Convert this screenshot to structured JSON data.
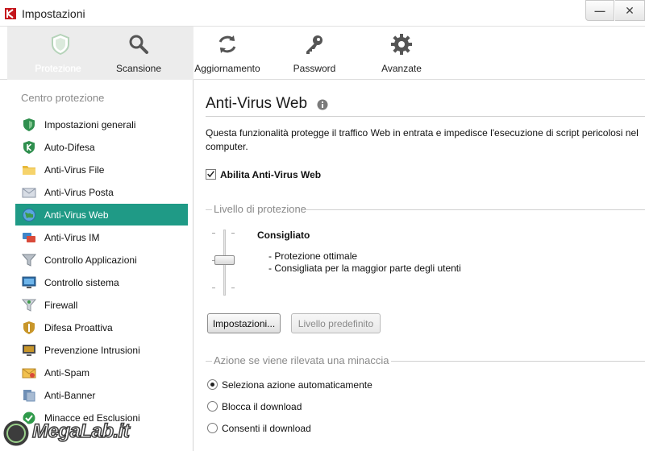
{
  "window": {
    "title": "Impostazioni",
    "minimize_glyph": "—",
    "close_glyph": "✕"
  },
  "toolbar": {
    "items": [
      {
        "label": "Protezione",
        "icon": "shield-icon",
        "active": true
      },
      {
        "label": "Scansione",
        "icon": "magnifier-icon",
        "active": false
      },
      {
        "label": "Aggiornamento",
        "icon": "refresh-icon",
        "active": false
      },
      {
        "label": "Password",
        "icon": "key-icon",
        "active": false
      },
      {
        "label": "Avanzate",
        "icon": "gear-icon",
        "active": false
      }
    ]
  },
  "sidebar": {
    "heading": "Centro protezione",
    "items": [
      {
        "label": "Impostazioni generali",
        "icon": "shield-icon"
      },
      {
        "label": "Auto-Difesa",
        "icon": "k-shield-icon"
      },
      {
        "label": "Anti-Virus File",
        "icon": "folder-icon"
      },
      {
        "label": "Anti-Virus Posta",
        "icon": "envelope-icon"
      },
      {
        "label": "Anti-Virus Web",
        "icon": "globe-icon",
        "selected": true
      },
      {
        "label": "Anti-Virus IM",
        "icon": "chat-icon"
      },
      {
        "label": "Controllo Applicazioni",
        "icon": "funnel-icon"
      },
      {
        "label": "Controllo sistema",
        "icon": "monitor-icon"
      },
      {
        "label": "Firewall",
        "icon": "firewall-icon"
      },
      {
        "label": "Difesa Proattiva",
        "icon": "proactive-shield-icon"
      },
      {
        "label": "Prevenzione Intrusioni",
        "icon": "intrusion-monitor-icon"
      },
      {
        "label": "Anti-Spam",
        "icon": "spam-envelope-icon"
      },
      {
        "label": "Anti-Banner",
        "icon": "banner-icon"
      },
      {
        "label": "Minacce ed Esclusioni",
        "icon": "check-circle-icon"
      }
    ]
  },
  "main": {
    "title": "Anti-Virus Web",
    "description": "Questa funzionalità protegge il traffico Web in entrata e impedisce l'esecuzione di script pericolosi nel computer.",
    "enable_label": "Abilita Anti-Virus Web",
    "enable_checked": true,
    "protection_group_title": "Livello di protezione",
    "level": {
      "name": "Consigliato",
      "lines": [
        "- Protezione ottimale",
        "- Consigliata per la maggior parte degli utenti"
      ]
    },
    "buttons": {
      "settings": "Impostazioni...",
      "default_level": "Livello predefinito"
    },
    "action_group_title": "Azione se viene rilevata una minaccia",
    "actions": [
      {
        "label": "Seleziona azione automaticamente",
        "selected": true
      },
      {
        "label": "Blocca il download",
        "selected": false
      },
      {
        "label": "Consenti il download",
        "selected": false
      }
    ]
  },
  "watermark": {
    "text": "MegaLab.it"
  },
  "colors": {
    "selected_item": "#1f9a86",
    "kaspersky_red": "#c4161c",
    "icon_green": "#2f8f4e"
  }
}
